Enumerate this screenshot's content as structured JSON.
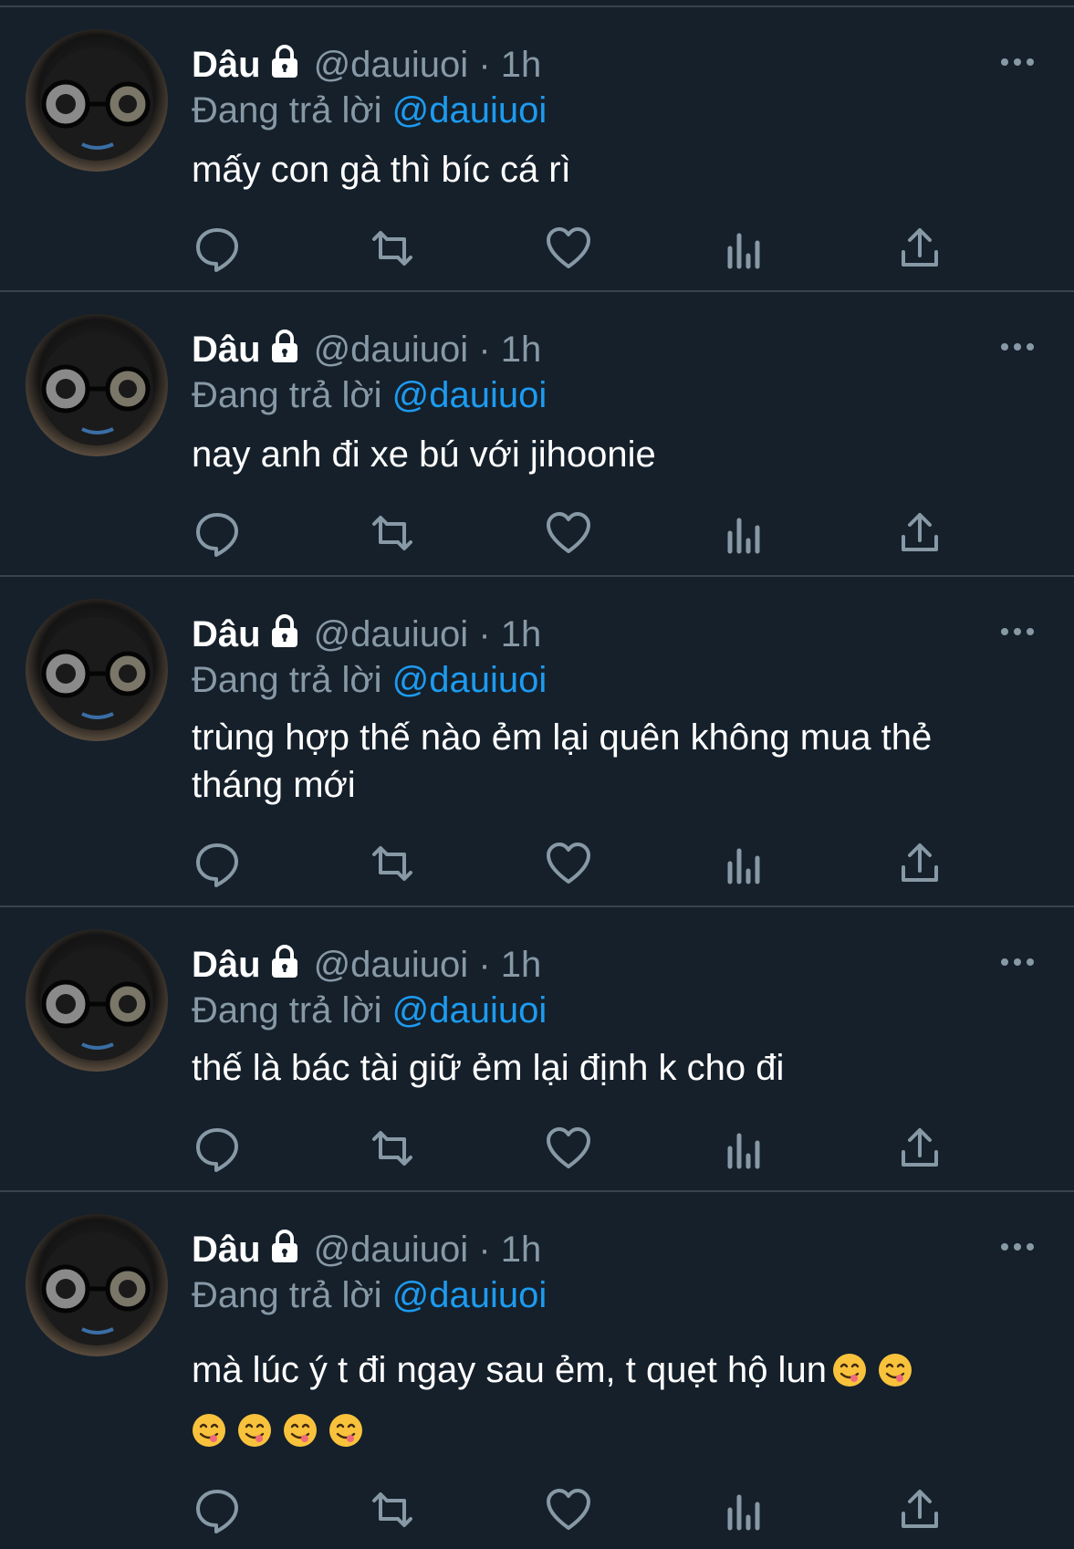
{
  "tweets": [
    {
      "name": "Dâu",
      "handle": "@dauiuoi",
      "dot": "·",
      "time": "1h",
      "reply_prefix": "Đang trả lời",
      "reply_mention": "@dauiuoi",
      "text": "mấy con gà thì bíc cá rì"
    },
    {
      "name": "Dâu",
      "handle": "@dauiuoi",
      "dot": "·",
      "time": "1h",
      "reply_prefix": "Đang trả lời",
      "reply_mention": "@dauiuoi",
      "text": "nay anh đi xe bú với jihoonie"
    },
    {
      "name": "Dâu",
      "handle": "@dauiuoi",
      "dot": "·",
      "time": "1h",
      "reply_prefix": "Đang trả lời",
      "reply_mention": "@dauiuoi",
      "text": "trùng hợp thế nào ẻm lại quên không mua thẻ tháng mới"
    },
    {
      "name": "Dâu",
      "handle": "@dauiuoi",
      "dot": "·",
      "time": "1h",
      "reply_prefix": "Đang trả lời",
      "reply_mention": "@dauiuoi",
      "text": "thế là bác tài giữ ẻm lại định k cho đi"
    },
    {
      "name": "Dâu",
      "handle": "@dauiuoi",
      "dot": "·",
      "time": "1h",
      "reply_prefix": "Đang trả lời",
      "reply_mention": "@dauiuoi",
      "text": "mà lúc ý t đi ngay sau ẻm, t quẹt hộ lun"
    }
  ],
  "icons": {
    "lock": "lock-icon",
    "more": "more-options-icon",
    "reply": "reply-icon",
    "retweet": "retweet-icon",
    "like": "heart-icon",
    "analytics": "analytics-icon",
    "share": "share-icon",
    "emoji": "face-savoring-food-emoji"
  },
  "colors": {
    "background": "#15202b",
    "divider": "#38444d",
    "secondary_text": "#8899a6",
    "link": "#1d9bf0",
    "primary_text": "#ffffff"
  }
}
